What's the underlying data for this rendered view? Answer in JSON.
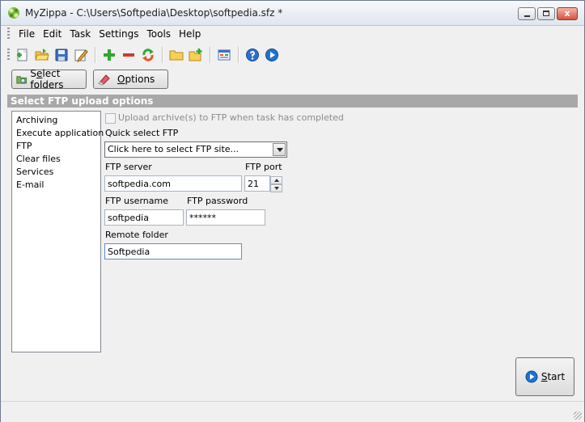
{
  "window": {
    "title": "MyZippa - C:\\Users\\Softpedia\\Desktop\\softpedia.sfz *",
    "close_glyph": "x"
  },
  "menu": [
    "File",
    "Edit",
    "Task",
    "Settings",
    "Tools",
    "Help"
  ],
  "toolbar_icons": [
    "new-task-icon",
    "open-icon",
    "save-icon",
    "edit-icon",
    "add-icon",
    "remove-icon",
    "refresh-icon",
    "folder-icon",
    "add-folder-icon",
    "view-icon",
    "help-icon",
    "run-icon"
  ],
  "buttons": {
    "select_folders_pre": "S",
    "select_folders_ul": "e",
    "select_folders_post": "lect folders",
    "options_ul": "O",
    "options_post": "ptions",
    "start_ul": "S",
    "start_post": "tart"
  },
  "section_header": "Select FTP upload options",
  "nav_items": [
    "Archiving",
    "Execute application",
    "FTP",
    "Clear files",
    "Services",
    "E-mail"
  ],
  "form": {
    "upload_checkbox_label": "Upload archive(s) to FTP when task has completed",
    "upload_checked": false,
    "quick_select_label": "Quick select FTP",
    "quick_select_value": "Click here to select FTP site...",
    "server_label": "FTP server",
    "server_value": "softpedia.com",
    "port_label": "FTP port",
    "port_value": "21",
    "username_label": "FTP username",
    "username_value": "softpedia",
    "password_label": "FTP password",
    "password_value": "******",
    "remote_folder_label": "Remote folder",
    "remote_folder_value": "Softpedia"
  },
  "colors": {
    "section_header_bg": "#a8a8a8",
    "add_green": "#2fa82f",
    "remove_red": "#d23a2a",
    "run_blue": "#1e73d2"
  }
}
